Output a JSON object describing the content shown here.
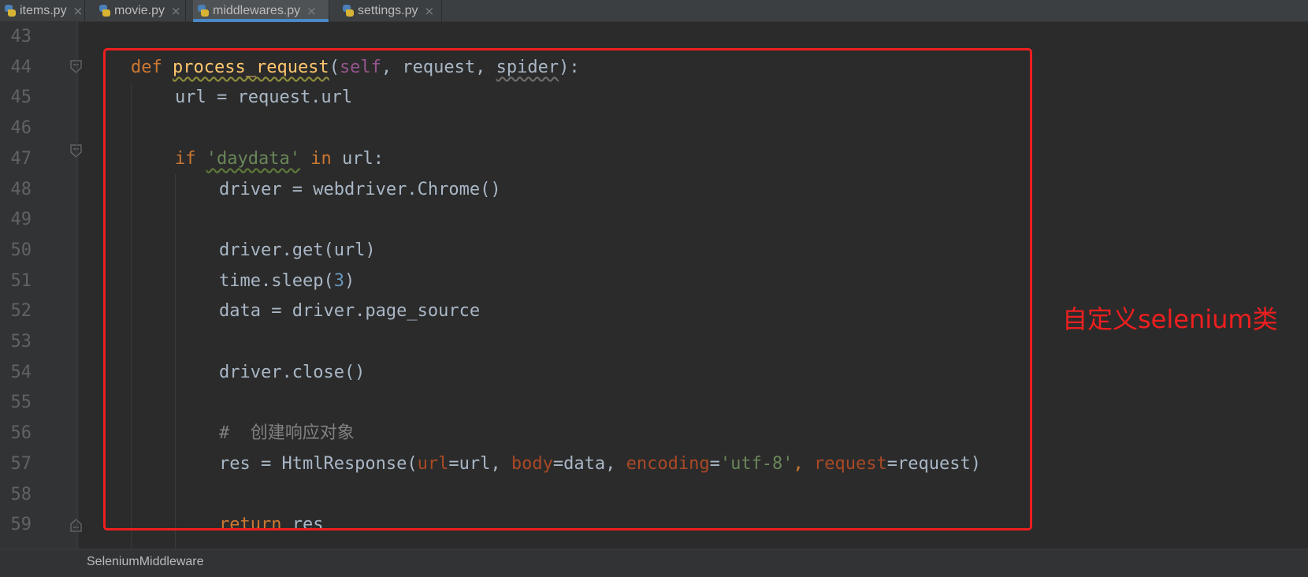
{
  "tabs": [
    {
      "label": "items.py",
      "icon": "python-file-icon",
      "active": false
    },
    {
      "label": "movie.py",
      "icon": "python-file-icon",
      "active": false
    },
    {
      "label": "middlewares.py",
      "icon": "python-file-icon",
      "active": true
    },
    {
      "label": "settings.py",
      "icon": "python-file-icon",
      "active": false
    }
  ],
  "tab_close_glyph": "×",
  "gutter": {
    "line_numbers": [
      "43",
      "44",
      "45",
      "46",
      "47",
      "48",
      "49",
      "50",
      "51",
      "52",
      "53",
      "54",
      "55",
      "56",
      "57",
      "58",
      "59"
    ]
  },
  "code": {
    "line44": {
      "kw": "def",
      "fn": "process_request",
      "p1": "(",
      "self": "self",
      "p2": ", request, ",
      "spider": "spider",
      "p3": "):"
    },
    "line45": {
      "text": "url = request.url"
    },
    "line47": {
      "kw_if": "if",
      "str": "'daydata'",
      "kw_in": "in",
      "rest": " url:"
    },
    "line48": {
      "text": "driver = webdriver.Chrome()"
    },
    "line50": {
      "text": "driver.get(url)"
    },
    "line51": {
      "pre": "time.sleep(",
      "num": "3",
      "post": ")"
    },
    "line52": {
      "text": "data = driver.page_source"
    },
    "line54": {
      "text": "driver.close()"
    },
    "line56": {
      "text": "#  创建响应对象"
    },
    "line57": {
      "pre": "res = HtmlResponse(",
      "k1": "url",
      "v1": "=url, ",
      "k2": "body",
      "v2": "=data, ",
      "k3": "encoding",
      "eq3": "=",
      "s3": "'utf-8'",
      "c3": ", ",
      "k4": "request",
      "v4": "=request)"
    },
    "line59": {
      "kw": "return",
      "rest": " res"
    }
  },
  "annotation": "自定义selenium类",
  "breadcrumb": "SeleniumMiddleware",
  "colors": {
    "editor_bg": "#2b2b2b",
    "keyword": "#cc7832",
    "function": "#ffc66d",
    "self": "#94558d",
    "string": "#6a8759",
    "number": "#6897bb",
    "comment": "#808080",
    "highlight": "#ee1f1f"
  }
}
